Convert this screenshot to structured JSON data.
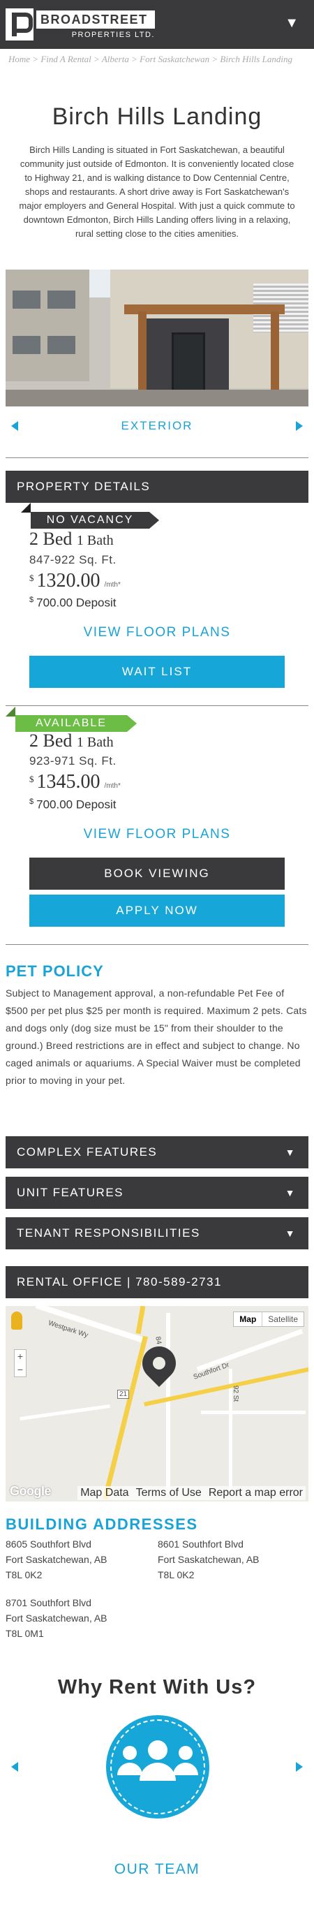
{
  "header": {
    "brand_name": "BROADSTREET",
    "brand_sub": "PROPERTIES LTD.",
    "menu_icon": "chevron-down-icon",
    "menu_symbol": "▼"
  },
  "breadcrumb": [
    "Home",
    "Find A Rental",
    "Alberta",
    "Fort Saskatchewan",
    "Birch Hills Landing"
  ],
  "breadcrumb_sep": ">",
  "page": {
    "title": "Birch Hills Landing",
    "intro": "Birch Hills Landing is situated in Fort Saskatchewan, a beautiful community just outside of Edmonton. It is conveniently located close to Highway 21, and is walking distance to Dow Centennial Centre, shops and restaurants. A short drive away is Fort Saskatchewan's major employers and General Hospital. With just a quick commute to downtown Edmonton, Birch Hills Landing offers living in a relaxing, rural setting close to the cities amenities."
  },
  "gallery": {
    "caption": "EXTERIOR"
  },
  "property_details": {
    "heading": "PROPERTY DETAILS",
    "units": [
      {
        "status": "NO VACANCY",
        "beds": "2 Bed",
        "baths": "1 Bath",
        "sqft": "847-922 Sq. Ft.",
        "currency": "$",
        "price": "1320.00",
        "per": "/mth*",
        "deposit": "700.00 Deposit",
        "floor_plans": "VIEW FLOOR PLANS",
        "buttons": [
          "WAIT LIST"
        ]
      },
      {
        "status": "AVAILABLE",
        "beds": "2 Bed",
        "baths": "1 Bath",
        "sqft": "923-971 Sq. Ft.",
        "currency": "$",
        "price": "1345.00",
        "per": "/mth*",
        "deposit": "700.00 Deposit",
        "floor_plans": "VIEW FLOOR PLANS",
        "buttons": [
          "BOOK VIEWING",
          "APPLY NOW"
        ]
      }
    ]
  },
  "pet_policy": {
    "title": "PET POLICY",
    "text": "Subject to Management approval, a non-refundable Pet Fee of $500 per pet plus $25 per month is required. Maximum 2 pets. Cats and dogs only (dog size must be 15\" from their shoulder to the ground.) Breed restrictions are in effect and subject to change. No caged animals or aquariums. A Special Waiver must be completed prior to moving in your pet."
  },
  "accordions": [
    {
      "label": "COMPLEX FEATURES"
    },
    {
      "label": "UNIT FEATURES"
    },
    {
      "label": "TENANT RESPONSIBILITIES"
    }
  ],
  "rental_office": "RENTAL OFFICE | 780-589-2731",
  "map": {
    "type_map": "Map",
    "type_satellite": "Satellite",
    "logo": "Google",
    "attribution": [
      "Map Data",
      "Terms of Use",
      "Report a map error"
    ],
    "labels": [
      "Westpark Wy",
      "Southfort Dr",
      "84 St",
      "92 St",
      "21"
    ]
  },
  "addresses": {
    "title": "BUILDING ADDRESSES",
    "items": [
      {
        "line1": "8605 Southfort Blvd",
        "line2": "Fort Saskatchewan, AB",
        "line3": "T8L 0K2"
      },
      {
        "line1": "8601 Southfort Blvd",
        "line2": "Fort Saskatchewan, AB",
        "line3": "T8L 0K2"
      },
      {
        "line1": "8701 Southfort Blvd",
        "line2": "Fort Saskatchewan, AB",
        "line3": "T8L 0M1"
      }
    ]
  },
  "why": {
    "title": "Why Rent With Us?",
    "icon": "people-group-icon",
    "link": "OUR TEAM"
  },
  "colors": {
    "accent": "#1aa3d6",
    "dark": "#3a3a3c",
    "available": "#6cbd45"
  }
}
